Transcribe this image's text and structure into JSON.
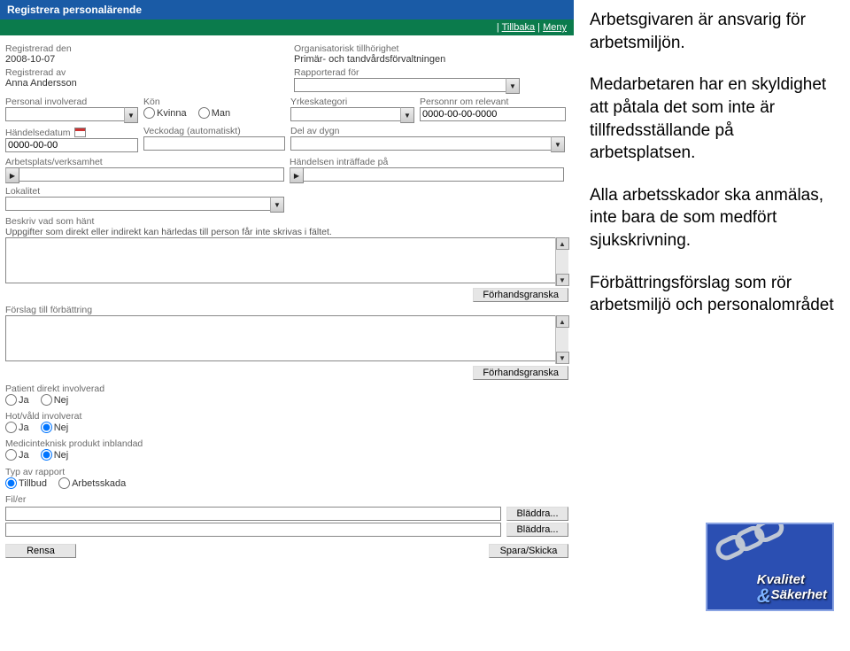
{
  "title": "Registrera personalärende",
  "topnav": {
    "back": "Tillbaka",
    "menu": "Meny",
    "sep": "|"
  },
  "meta": {
    "registered_label": "Registrerad den",
    "registered_value": "2008-10-07",
    "registered_by_label": "Registrerad av",
    "registered_by_value": "Anna Andersson",
    "org_label": "Organisatorisk tillhörighet",
    "org_value": "Primär- och tandvårdsförvaltningen",
    "reported_for_label": "Rapporterad för",
    "reported_for_value": ""
  },
  "row1": {
    "personal_label": "Personal involverad",
    "personal_value": "",
    "kon_label": "Kön",
    "kon_kvinna": "Kvinna",
    "kon_man": "Man",
    "yrke_label": "Yrkeskategori",
    "yrke_value": "",
    "personnr_label": "Personnr om relevant",
    "personnr_value": "0000-00-00-0000"
  },
  "row2": {
    "handelsedatum_label": "Händelsedatum",
    "handelsedatum_value": "0000-00-00",
    "veckodag_label": "Veckodag (automatiskt)",
    "veckodag_value": "",
    "dygn_label": "Del av dygn",
    "dygn_value": ""
  },
  "row3": {
    "arbetsplats_label": "Arbetsplats/verksamhet",
    "arbetsplats_value": "",
    "handelse_label": "Händelsen inträffade på",
    "handelse_value": ""
  },
  "lokalitet": {
    "label": "Lokalitet",
    "value": ""
  },
  "beskriv": {
    "title": "Beskriv vad som hänt",
    "hint": "Uppgifter som direkt eller indirekt kan härledas till person får inte skrivas i fältet.",
    "value": "",
    "preview_btn": "Förhandsgranska"
  },
  "forslag": {
    "title": "Förslag till förbättring",
    "value": "",
    "preview_btn": "Förhandsgranska"
  },
  "flags": {
    "patient_label": "Patient direkt involverad",
    "hot_label": "Hot/våld involverat",
    "medtech_label": "Medicinteknisk produkt inblandad",
    "ja": "Ja",
    "nej": "Nej"
  },
  "rapport": {
    "label": "Typ av rapport",
    "tillbud": "Tillbud",
    "arbetsskada": "Arbetsskada"
  },
  "files": {
    "label": "Fil/er",
    "browse": "Bläddra..."
  },
  "bottom": {
    "rensa": "Rensa",
    "spara": "Spara/Skicka"
  },
  "side": {
    "p1": "Arbetsgivaren är ansvarig för arbetsmiljön.",
    "p2": "Medarbetaren har en skyldighet att påtala det som inte är tillfredsställande på arbetsplatsen.",
    "p3": "Alla arbetsskador ska anmälas, inte bara de som medfört sjukskrivning.",
    "p4": "Förbättringsförslag som rör arbetsmiljö och personalområdet",
    "brand1": "Kvalitet",
    "brand2": "Säkerhet"
  }
}
